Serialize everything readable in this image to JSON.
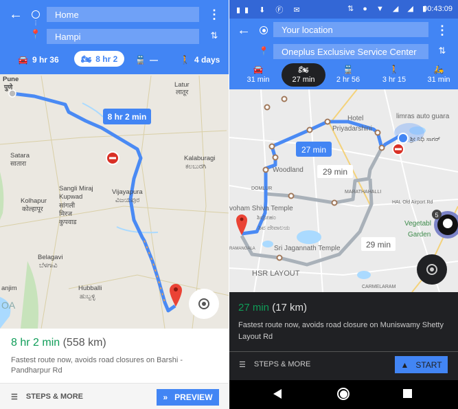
{
  "left": {
    "origin": "Home",
    "destination": "Hampi",
    "modes": [
      {
        "icon": "car-icon",
        "label": "9 hr 36"
      },
      {
        "icon": "motorcycle-icon",
        "label": "8 hr 2",
        "selected": true
      },
      {
        "icon": "train-icon",
        "label": "—"
      },
      {
        "icon": "walk-icon",
        "label": "4 days"
      }
    ],
    "map": {
      "route_label": "8 hr 2 min",
      "places": [
        [
          "Pune",
          "पुणे"
        ],
        [
          "Latur",
          "लातूर"
        ],
        [
          "Satara",
          "सातारा"
        ],
        [
          "Kalaburagi",
          "ಕಲಬುರಗಿ"
        ],
        [
          "Sangli Miraj",
          "Kupwad"
        ],
        [
          "सांगली",
          "मिरज"
        ],
        [
          "कुपवाड",
          ""
        ],
        [
          "Kolhapur",
          "कोल्हापूर"
        ],
        [
          "Vijayapura",
          "ವಿಜಯಪುರ"
        ],
        [
          "Belagavi",
          "ಬೆಳಗಾವಿ"
        ],
        [
          "Hubballi",
          "ಹುಬ್ಬಳ್ಳಿ"
        ],
        [
          "anjim",
          ""
        ],
        [
          "OA",
          ""
        ]
      ]
    },
    "summary": {
      "time": "8 hr 2 min",
      "distance": "(558 km)",
      "note": "Fastest route now, avoids road closures on Barshi - Pandharpur Rd"
    },
    "steps_label": "STEPS & MORE",
    "preview_label": "PREVIEW"
  },
  "right": {
    "status_time": "00:43:09",
    "origin": "Your location",
    "destination": "Oneplus Exclusive Service Center",
    "modes": [
      {
        "icon": "car-icon",
        "label": "31 min"
      },
      {
        "icon": "motorcycle-icon",
        "label": "27 min",
        "selected": true
      },
      {
        "icon": "train-icon",
        "label": "2 hr 56"
      },
      {
        "icon": "walk-icon",
        "label": "3 hr 15"
      },
      {
        "icon": "ride-icon",
        "label": "31 min"
      }
    ],
    "map": {
      "route_label": "27 min",
      "alt_labels": [
        "29 min",
        "29 min"
      ],
      "badge_count": "5",
      "places": [
        "Hotel",
        "Priyadarshini",
        "limras auto guara",
        "ಶ್ರೀ ನಿಧಿ ಸಾಗರ್",
        "Woodland",
        "DOMLUR",
        "MARATHAHALLI",
        "HAL Old Airport Rd",
        "voham Shiva Temple",
        "ಶಿವೋಹಂ",
        "ಶಿವ ದೇವಾಲಯ",
        "Vegetabl",
        "Garden",
        "Sri Jagannath Temple",
        "RAMANGALA",
        "HSR LAYOUT",
        "CARMELARAM"
      ]
    },
    "summary": {
      "time": "27 min",
      "distance": "(17 km)",
      "note": "Fastest route now, avoids road closure on Muniswamy Shetty Layout Rd"
    },
    "steps_label": "STEPS & MORE",
    "start_label": "START"
  },
  "colors": {
    "primary": "#4285f4",
    "route": "#4a8af4",
    "alt_route": "#a9b1b9",
    "time_green": "#0f9d58",
    "closure": "#d93025",
    "dark": "#202124"
  }
}
